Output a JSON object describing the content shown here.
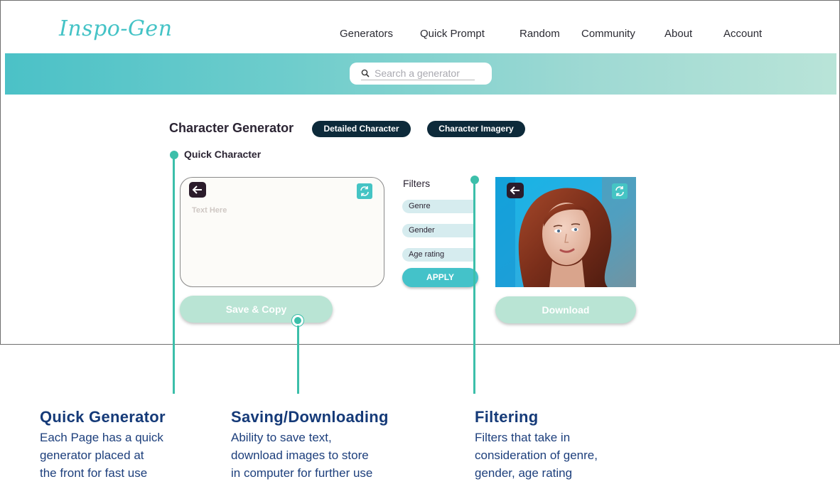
{
  "app": {
    "logo": "Inspo-Gen",
    "nav": [
      "Generators",
      "Quick Prompt",
      "Random",
      "Community",
      "About",
      "Account"
    ],
    "search_placeholder": "Search a generator"
  },
  "page": {
    "title": "Character Generator",
    "tabs": [
      "Detailed Character",
      "Character Imagery"
    ],
    "section_label": "Quick Character"
  },
  "text_panel": {
    "placeholder": "Text Here",
    "save_label": "Save  & Copy"
  },
  "filters": {
    "title": "Filters",
    "items": [
      "Genre",
      "Gender",
      "Age rating"
    ],
    "apply_label": "APPLY"
  },
  "image_panel": {
    "image": "portrait of a red-haired woman",
    "download_label": "Download"
  },
  "icons": {
    "search": "search-icon",
    "back": "arrow-left-icon",
    "refresh": "refresh-icon"
  },
  "colors": {
    "accent": "#44c3c6",
    "dark_pill": "#0d2a3a",
    "annotation_line": "#3cbfaa",
    "callout_text": "#153a78",
    "soft_button": "#b9e4d4"
  },
  "callouts": [
    {
      "title": "Quick Generator",
      "lines": [
        "Each Page has a quick",
        "generator placed at",
        "the front for fast use"
      ]
    },
    {
      "title": "Saving/Downloading",
      "lines": [
        "Ability to save text,",
        "download images to store",
        "in computer for further use"
      ]
    },
    {
      "title": "Filtering",
      "lines": [
        "Filters that take in",
        "consideration of genre,",
        "gender, age rating"
      ]
    }
  ]
}
